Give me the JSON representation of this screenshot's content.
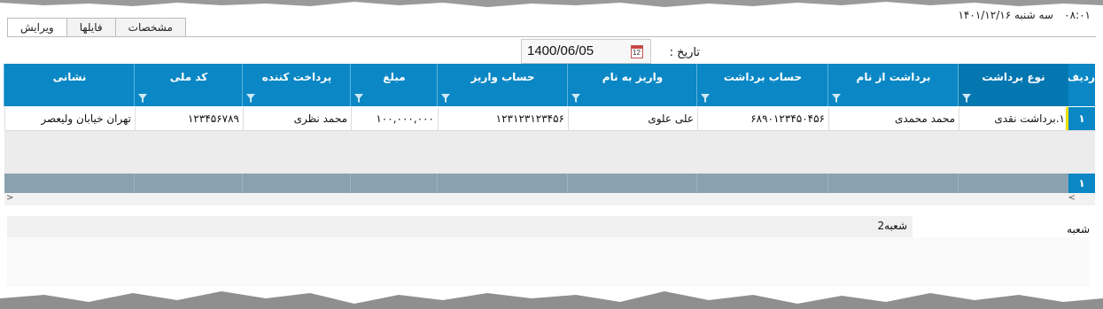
{
  "header": {
    "time": "۰۸:۰۱",
    "date_text": "سه شنبه  ۱۴۰۱/۱۲/۱۶"
  },
  "tabs": [
    {
      "label": "ویرایش",
      "active": true
    },
    {
      "label": "فایلها",
      "active": false
    },
    {
      "label": "مشخصات",
      "active": false
    }
  ],
  "date_field": {
    "label": "تاریخ :",
    "value": "1400/06/05",
    "icon": "calendar-icon"
  },
  "grid": {
    "columns": [
      "ردیف",
      "نوع برداشت",
      "برداشت از نام",
      "حساب برداشت",
      "واریز به نام",
      "حساب واریز",
      "مبلغ",
      "پرداخت کننده",
      "کد ملی",
      "نشانی"
    ],
    "rows": [
      {
        "no": "۱",
        "type": "۱.برداشت نقدی",
        "from_name": "محمد محمدی",
        "from_account": "۶۸۹۰۱۲۳۴۵۰۴۵۶",
        "to_name": "علی علوی",
        "to_account": "۱۲۳۱۲۳۱۲۳۴۵۶",
        "amount": "۱۰۰,۰۰۰,۰۰۰",
        "payer": "محمد نظری",
        "national_code": "۱۲۳۴۵۶۷۸۹",
        "address": "تهران خیابان ولیعصر"
      }
    ],
    "footer_no": "۱"
  },
  "branch": {
    "label": "شعبه",
    "value": "شعبه2"
  }
}
